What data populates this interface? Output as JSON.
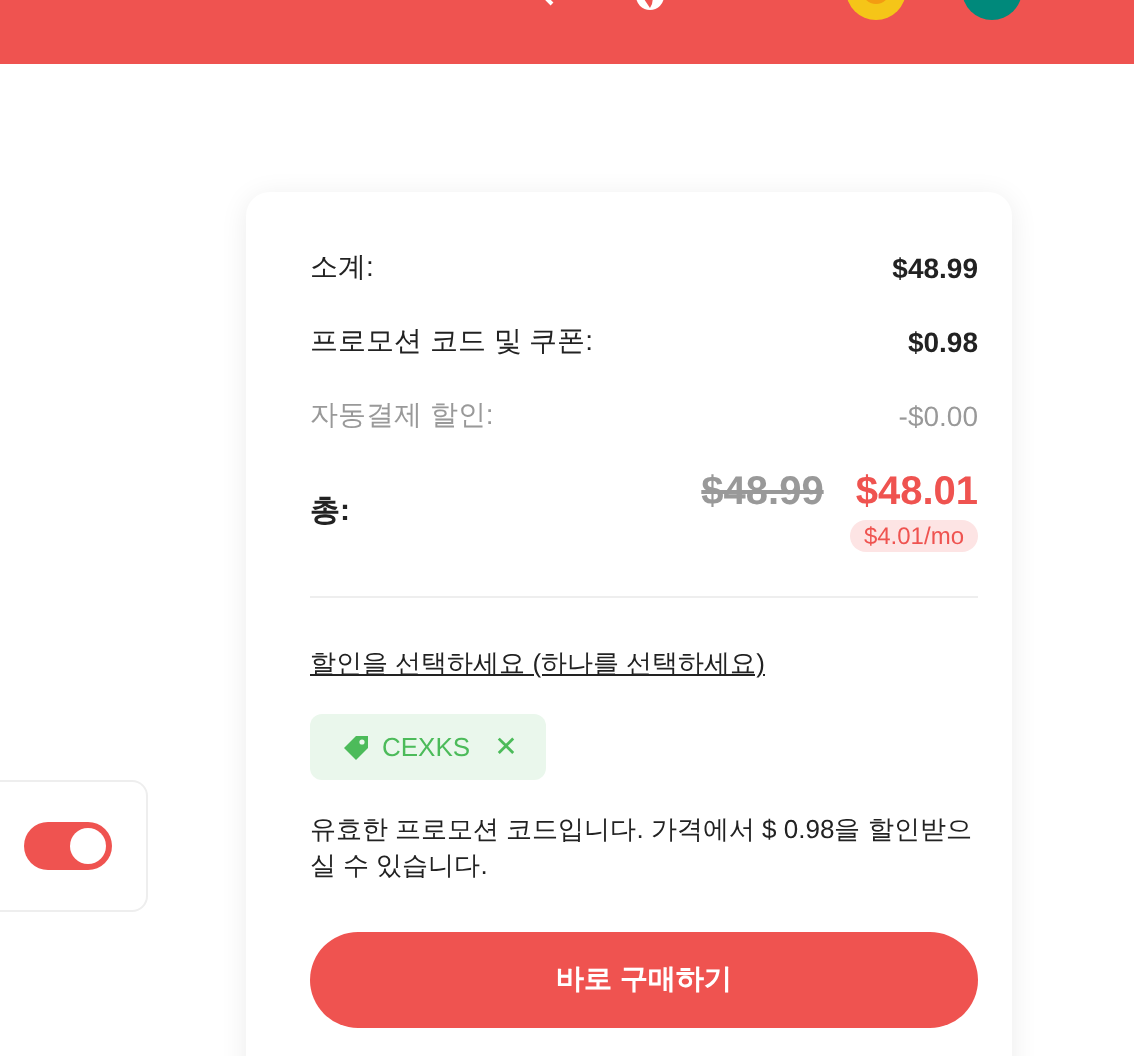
{
  "option_panel": {
    "toggle_on": true
  },
  "summary": {
    "rows": [
      {
        "label": "소계:",
        "value": "$48.99",
        "kind": "plain"
      },
      {
        "label": "프로모션 코드 및 쿠폰:",
        "value": "$0.98",
        "kind": "plain"
      },
      {
        "label": "자동결제 할인:",
        "value": "-$0.00",
        "kind": "muted"
      }
    ],
    "total": {
      "label": "총:",
      "old_price": "$48.99",
      "price": "$48.01",
      "monthly": "$4.01/mo"
    },
    "discount_link": "할인을 선택하세요 (하나를 선택하세요)",
    "coupon": {
      "code": "CEXKS",
      "close": "✕"
    },
    "message": "유효한 프로모션 코드입니다. 가격에서 $ 0.98을 할인받으실 수 있습니다.",
    "buy_button": "바로 구매하기"
  }
}
